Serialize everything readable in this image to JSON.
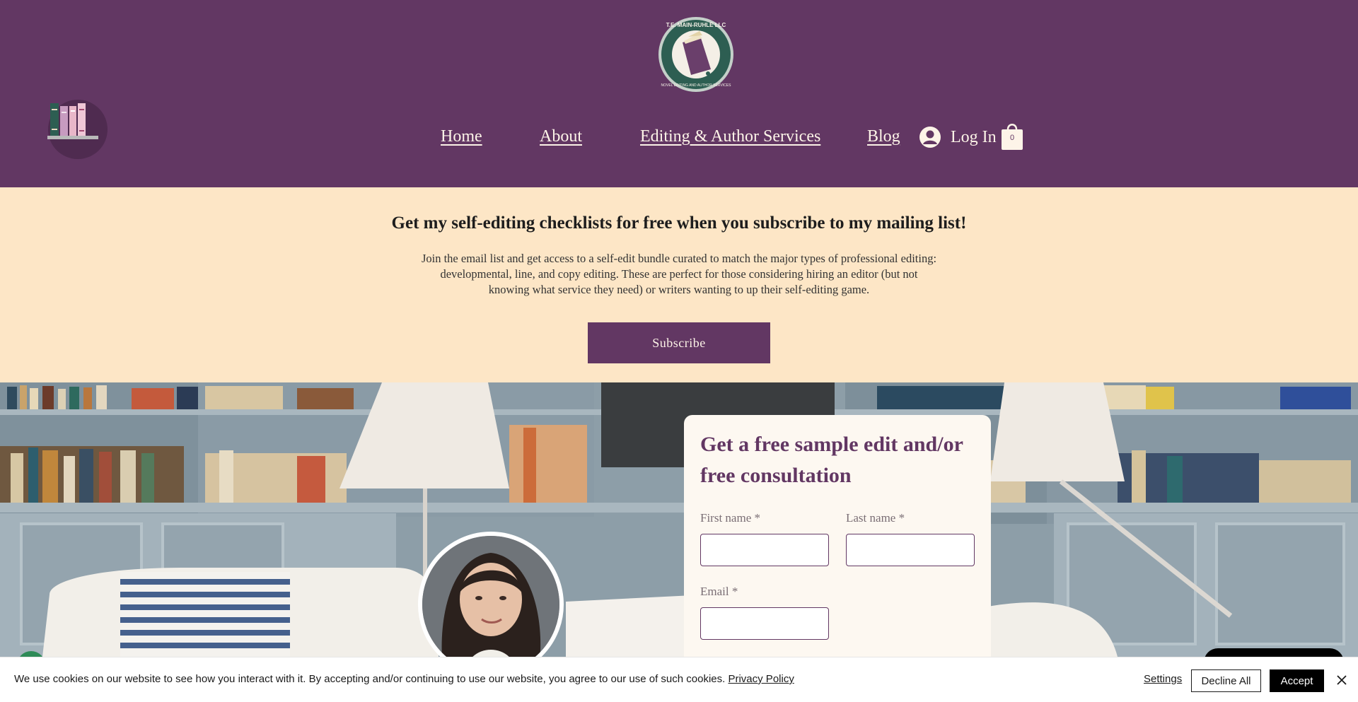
{
  "header": {
    "logo_text": "T.E. MAIN-RUHLE LLC · NOVEL EDITING AND AUTHOR SERVICES",
    "nav": [
      {
        "label": "Home"
      },
      {
        "label": "About"
      },
      {
        "label": "Editing & Author Services"
      },
      {
        "label": "Blog"
      }
    ],
    "login_label": "Log In",
    "cart_count": "0"
  },
  "subscribe": {
    "title": "Get my self-editing checklists for free when you subscribe to my mailing list!",
    "text": "Join the email list and get access to a self-edit bundle curated to match the major types of professional editing: developmental, line, and copy editing. These are perfect for those considering hiring an editor (but not knowing what service they need) or writers wanting to up their self-editing game.",
    "button_label": "Subscribe"
  },
  "form": {
    "title": "Get a free sample edit and/or free consultation",
    "first_name_label": "First name *",
    "last_name_label": "Last name *",
    "email_label": "Email *"
  },
  "cookie": {
    "text": "We use cookies on our website to see how you interact with it. By accepting and/or continuing to use our website, you agree to our use of such cookies.",
    "policy_link": "Privacy Policy",
    "settings_label": "Settings",
    "decline_label": "Decline All",
    "accept_label": "Accept"
  },
  "colors": {
    "brand_purple": "#623763",
    "cream": "#fde6c6",
    "logo_green": "#2d5e52"
  }
}
